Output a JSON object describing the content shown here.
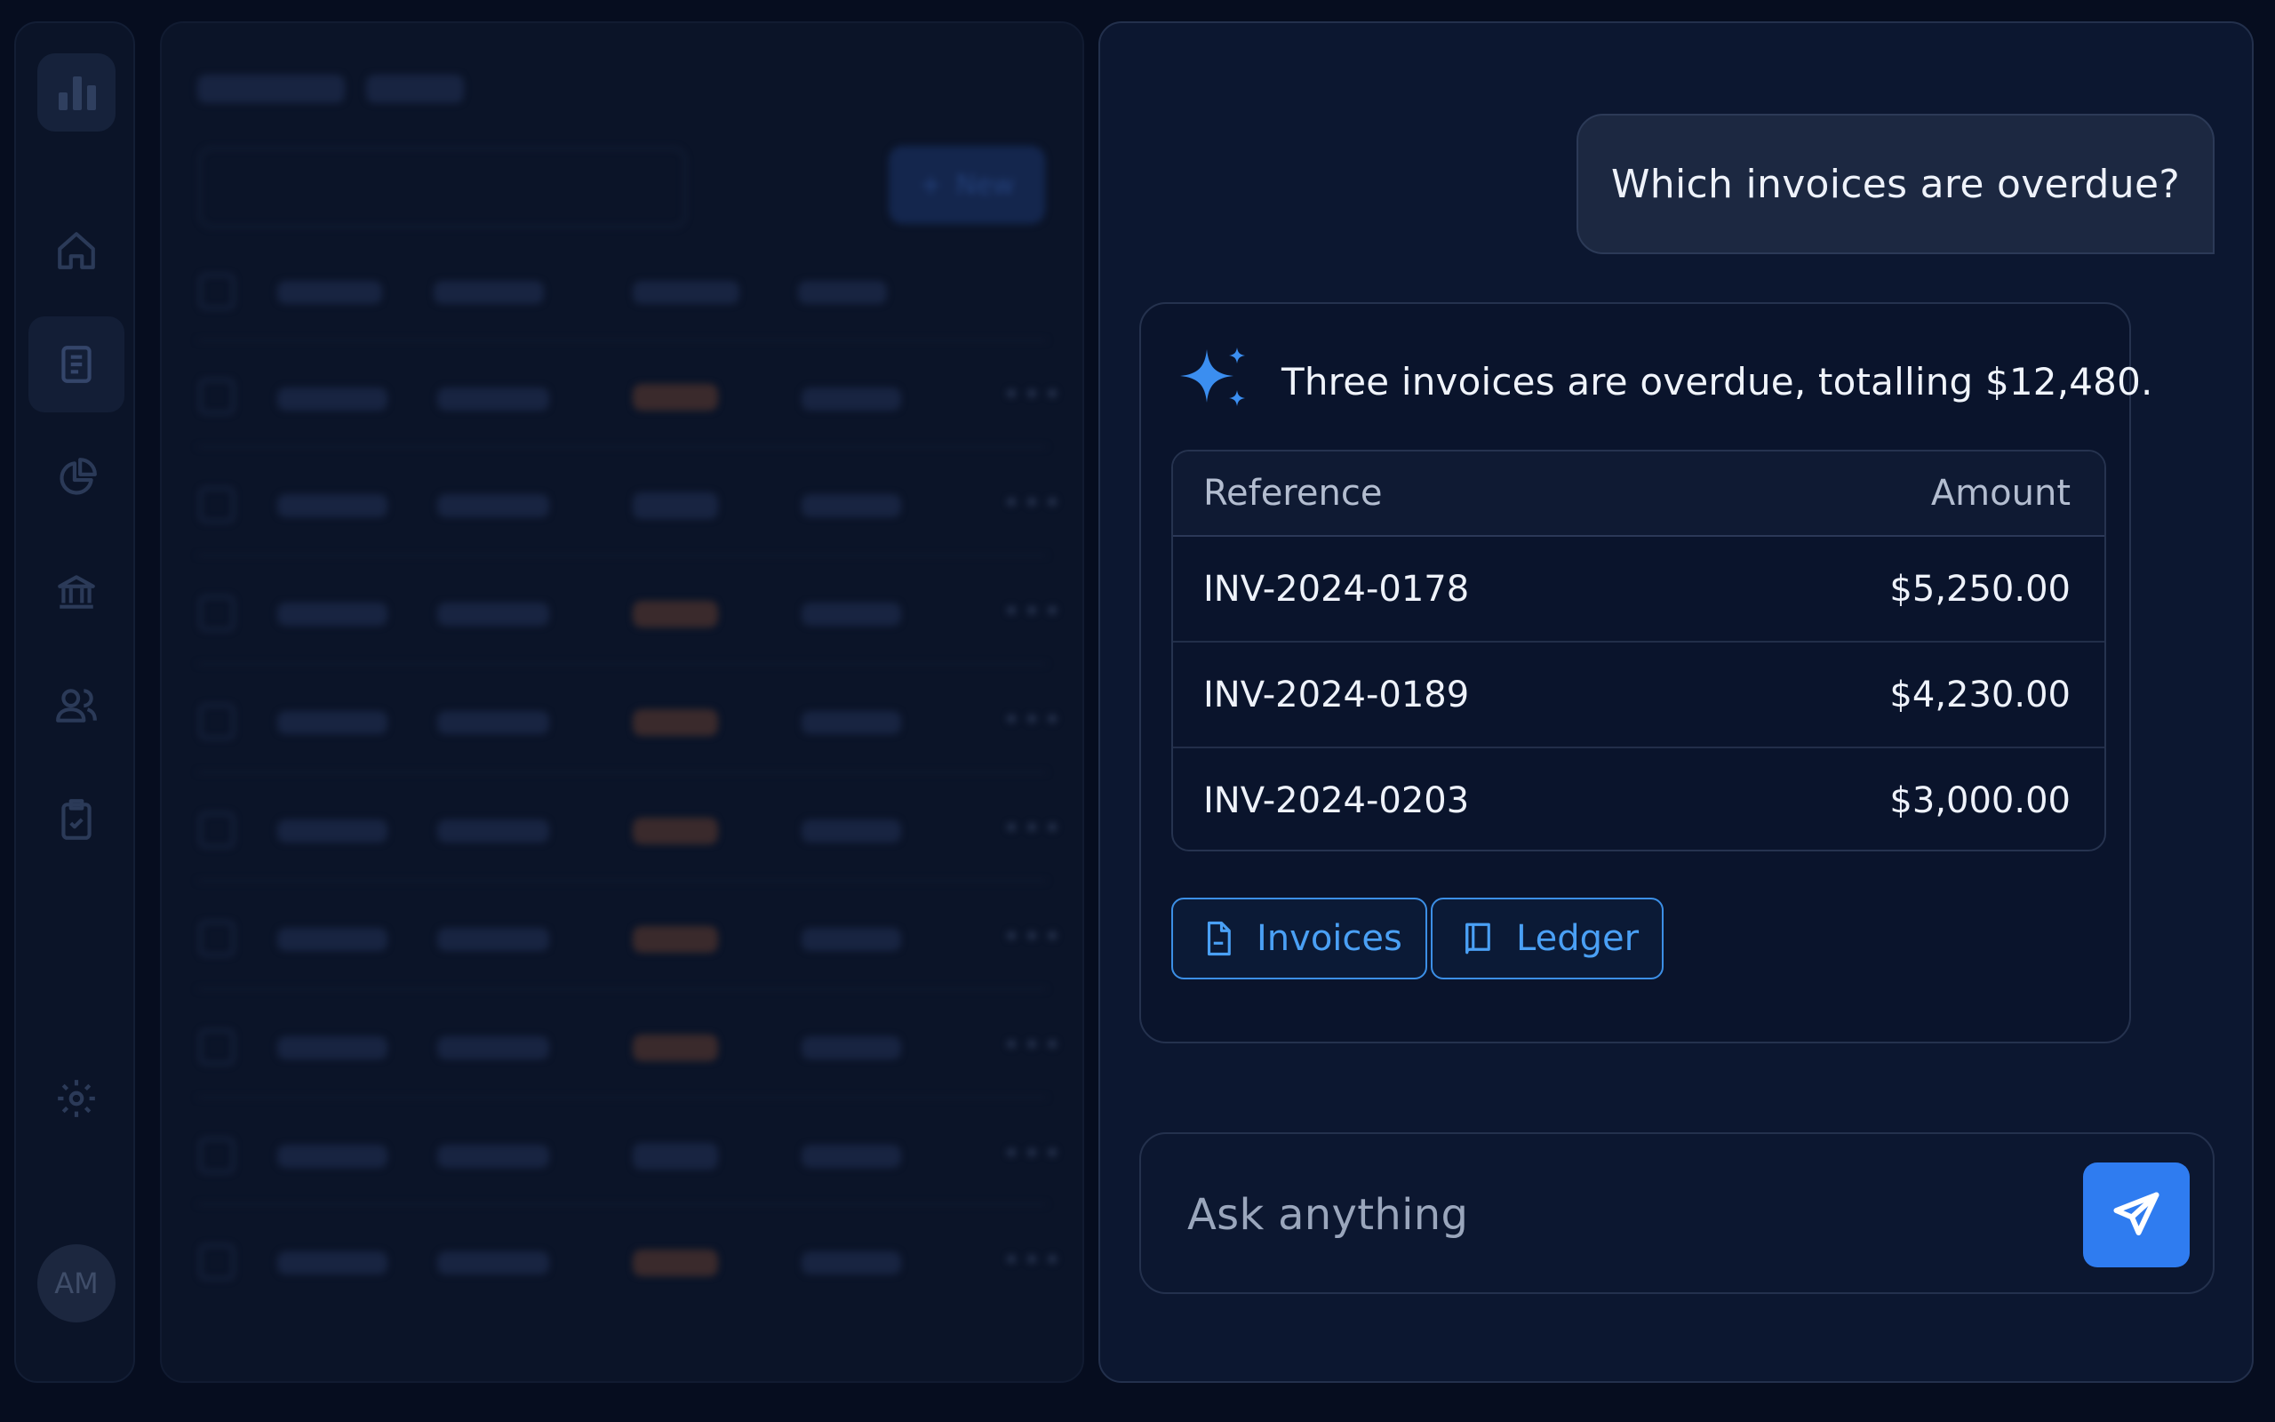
{
  "sidebar": {
    "avatar_initials": "AM",
    "items": [
      {
        "icon": "home-icon"
      },
      {
        "icon": "document-icon",
        "active": true
      },
      {
        "icon": "pie-chart-icon"
      },
      {
        "icon": "bank-icon"
      },
      {
        "icon": "users-icon"
      },
      {
        "icon": "clipboard-check-icon"
      },
      {
        "icon": "gear-icon"
      }
    ]
  },
  "background_panel": {
    "new_button_label": "New"
  },
  "chat": {
    "user_message": "Which invoices are overdue?",
    "assistant": {
      "summary": "Three invoices are overdue, totalling $12,480.",
      "table": {
        "headers": {
          "reference": "Reference",
          "amount": "Amount"
        },
        "rows": [
          {
            "reference": "INV-2024-0178",
            "amount": "$5,250.00"
          },
          {
            "reference": "INV-2024-0189",
            "amount": "$4,230.00"
          },
          {
            "reference": "INV-2024-0203",
            "amount": "$3,000.00"
          }
        ]
      },
      "sources": [
        {
          "label": "Invoices",
          "icon": "file-icon"
        },
        {
          "label": "Ledger",
          "icon": "book-icon"
        }
      ]
    },
    "composer": {
      "placeholder": "Ask anything"
    }
  },
  "colors": {
    "accent": "#2f7cf0",
    "link": "#4aa0f5",
    "background": "#060d1f"
  }
}
